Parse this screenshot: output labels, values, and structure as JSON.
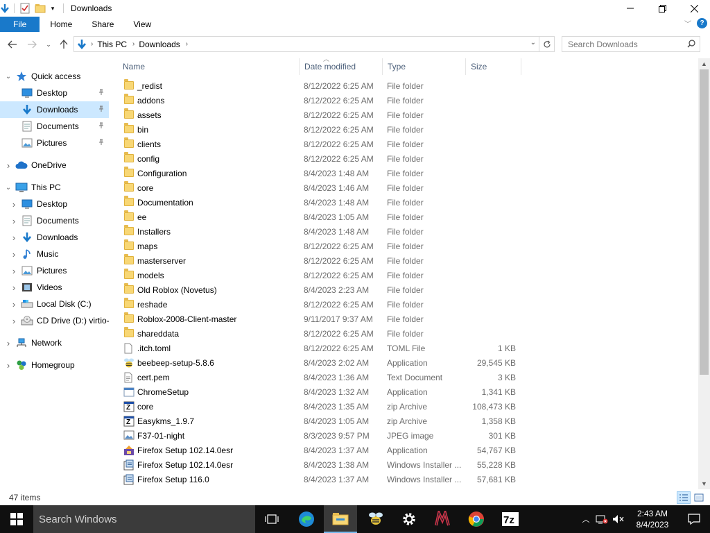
{
  "window": {
    "title": "Downloads"
  },
  "ribbon": {
    "tabs": [
      "File",
      "Home",
      "Share",
      "View"
    ]
  },
  "address": {
    "segments": [
      "This PC",
      "Downloads"
    ],
    "search_placeholder": "Search Downloads"
  },
  "navpane": {
    "items": [
      {
        "label": "Quick access",
        "icon": "star-icon",
        "level": 0,
        "expanded": true
      },
      {
        "label": "Desktop",
        "icon": "desktop-icon",
        "level": 1,
        "pinned": true
      },
      {
        "label": "Downloads",
        "icon": "downloads-icon",
        "level": 1,
        "pinned": true,
        "selected": true
      },
      {
        "label": "Documents",
        "icon": "documents-icon",
        "level": 1,
        "pinned": true
      },
      {
        "label": "Pictures",
        "icon": "pictures-icon",
        "level": 1,
        "pinned": true
      },
      {
        "label": "OneDrive",
        "icon": "cloud-icon",
        "level": 0,
        "expanded": false
      },
      {
        "label": "This PC",
        "icon": "computer-icon",
        "level": 0,
        "expanded": true
      },
      {
        "label": "Desktop",
        "icon": "desktop-icon",
        "level": 1
      },
      {
        "label": "Documents",
        "icon": "documents-icon",
        "level": 1
      },
      {
        "label": "Downloads",
        "icon": "downloads-icon",
        "level": 1
      },
      {
        "label": "Music",
        "icon": "music-icon",
        "level": 1
      },
      {
        "label": "Pictures",
        "icon": "pictures-icon",
        "level": 1
      },
      {
        "label": "Videos",
        "icon": "videos-icon",
        "level": 1
      },
      {
        "label": "Local Disk (C:)",
        "icon": "drive-icon",
        "level": 1
      },
      {
        "label": "CD Drive (D:) virtio-",
        "icon": "cd-drive-icon",
        "level": 1
      },
      {
        "label": "Network",
        "icon": "network-icon",
        "level": 0
      },
      {
        "label": "Homegroup",
        "icon": "homegroup-icon",
        "level": 0
      }
    ]
  },
  "columns": {
    "name": "Name",
    "date": "Date modified",
    "type": "Type",
    "size": "Size"
  },
  "files": [
    {
      "name": "_redist",
      "date": "8/12/2022 6:25 AM",
      "type": "File folder",
      "size": "",
      "icon": "folder"
    },
    {
      "name": "addons",
      "date": "8/12/2022 6:25 AM",
      "type": "File folder",
      "size": "",
      "icon": "folder"
    },
    {
      "name": "assets",
      "date": "8/12/2022 6:25 AM",
      "type": "File folder",
      "size": "",
      "icon": "folder"
    },
    {
      "name": "bin",
      "date": "8/12/2022 6:25 AM",
      "type": "File folder",
      "size": "",
      "icon": "folder"
    },
    {
      "name": "clients",
      "date": "8/12/2022 6:25 AM",
      "type": "File folder",
      "size": "",
      "icon": "folder"
    },
    {
      "name": "config",
      "date": "8/12/2022 6:25 AM",
      "type": "File folder",
      "size": "",
      "icon": "folder"
    },
    {
      "name": "Configuration",
      "date": "8/4/2023 1:48 AM",
      "type": "File folder",
      "size": "",
      "icon": "folder"
    },
    {
      "name": "core",
      "date": "8/4/2023 1:46 AM",
      "type": "File folder",
      "size": "",
      "icon": "folder"
    },
    {
      "name": "Documentation",
      "date": "8/4/2023 1:48 AM",
      "type": "File folder",
      "size": "",
      "icon": "folder"
    },
    {
      "name": "ee",
      "date": "8/4/2023 1:05 AM",
      "type": "File folder",
      "size": "",
      "icon": "folder"
    },
    {
      "name": "Installers",
      "date": "8/4/2023 1:48 AM",
      "type": "File folder",
      "size": "",
      "icon": "folder"
    },
    {
      "name": "maps",
      "date": "8/12/2022 6:25 AM",
      "type": "File folder",
      "size": "",
      "icon": "folder"
    },
    {
      "name": "masterserver",
      "date": "8/12/2022 6:25 AM",
      "type": "File folder",
      "size": "",
      "icon": "folder"
    },
    {
      "name": "models",
      "date": "8/12/2022 6:25 AM",
      "type": "File folder",
      "size": "",
      "icon": "folder"
    },
    {
      "name": "Old Roblox (Novetus)",
      "date": "8/4/2023 2:23 AM",
      "type": "File folder",
      "size": "",
      "icon": "folder"
    },
    {
      "name": "reshade",
      "date": "8/12/2022 6:25 AM",
      "type": "File folder",
      "size": "",
      "icon": "folder"
    },
    {
      "name": "Roblox-2008-Client-master",
      "date": "9/11/2017 9:37 AM",
      "type": "File folder",
      "size": "",
      "icon": "folder"
    },
    {
      "name": "shareddata",
      "date": "8/12/2022 6:25 AM",
      "type": "File folder",
      "size": "",
      "icon": "folder"
    },
    {
      "name": ".itch.toml",
      "date": "8/12/2022 6:25 AM",
      "type": "TOML File",
      "size": "1 KB",
      "icon": "document"
    },
    {
      "name": "beebeep-setup-5.8.6",
      "date": "8/4/2023 2:02 AM",
      "type": "Application",
      "size": "29,545 KB",
      "icon": "app-bee"
    },
    {
      "name": "cert.pem",
      "date": "8/4/2023 1:36 AM",
      "type": "Text Document",
      "size": "3 KB",
      "icon": "text"
    },
    {
      "name": "ChromeSetup",
      "date": "8/4/2023 1:32 AM",
      "type": "Application",
      "size": "1,341 KB",
      "icon": "app-generic"
    },
    {
      "name": "core",
      "date": "8/4/2023 1:35 AM",
      "type": "zip Archive",
      "size": "108,473 KB",
      "icon": "zip"
    },
    {
      "name": "Easykms_1.9.7",
      "date": "8/4/2023 1:05 AM",
      "type": "zip Archive",
      "size": "1,358 KB",
      "icon": "zip"
    },
    {
      "name": "F37-01-night",
      "date": "8/3/2023 9:57 PM",
      "type": "JPEG image",
      "size": "301 KB",
      "icon": "image"
    },
    {
      "name": "Firefox Setup 102.14.0esr",
      "date": "8/4/2023 1:37 AM",
      "type": "Application",
      "size": "54,767 KB",
      "icon": "app-installer"
    },
    {
      "name": "Firefox Setup 102.14.0esr",
      "date": "8/4/2023 1:38 AM",
      "type": "Windows Installer ...",
      "size": "55,228 KB",
      "icon": "msi"
    },
    {
      "name": "Firefox Setup 116.0",
      "date": "8/4/2023 1:37 AM",
      "type": "Windows Installer ...",
      "size": "57,681 KB",
      "icon": "msi"
    }
  ],
  "status": {
    "item_count": "47 items"
  },
  "taskbar": {
    "search_placeholder": "Search Windows",
    "time": "2:43 AM",
    "date": "8/4/2023"
  },
  "colors": {
    "accent": "#1979ca",
    "selection": "#cce8ff",
    "folder": "#f8d775"
  }
}
